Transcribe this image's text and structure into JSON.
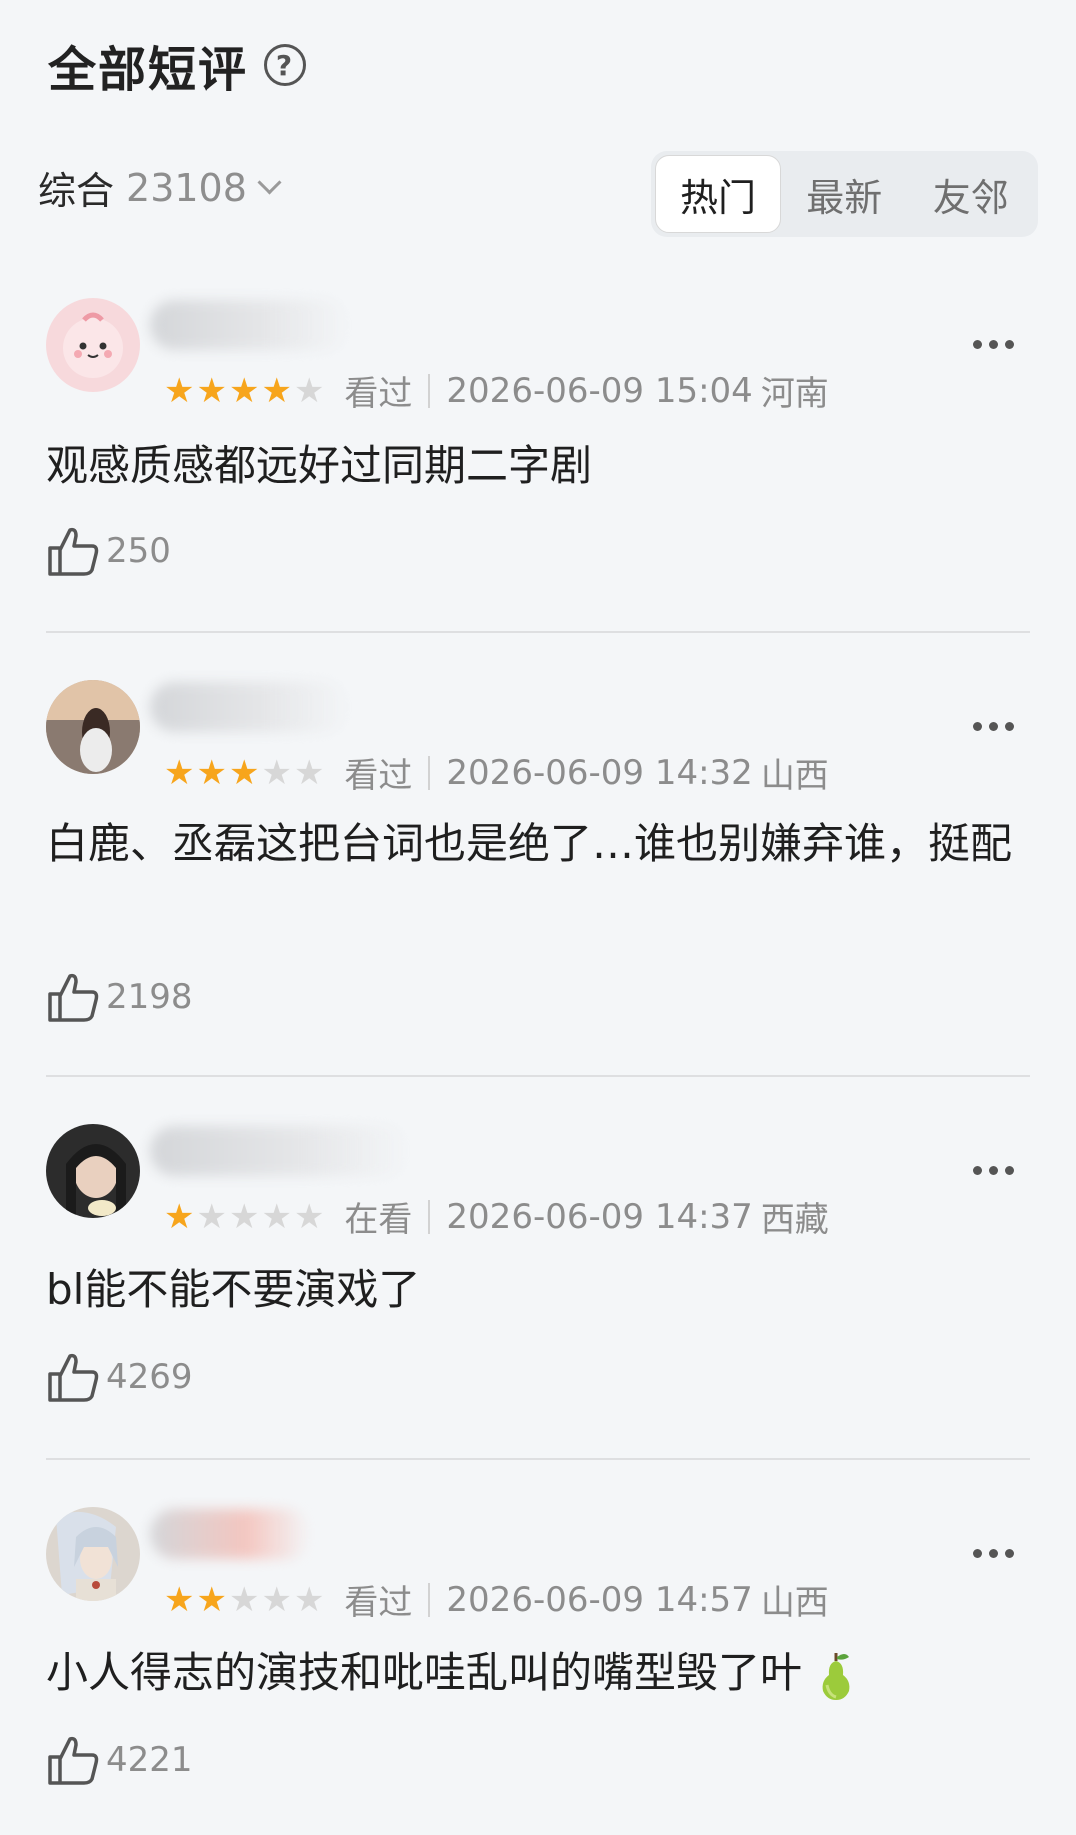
{
  "header": {
    "title": "全部短评",
    "help_icon": "?"
  },
  "sort": {
    "label": "综合",
    "count": "23108"
  },
  "tabs": [
    {
      "label": "热门",
      "active": true
    },
    {
      "label": "最新",
      "active": false
    },
    {
      "label": "友邻",
      "active": false
    }
  ],
  "reviews": [
    {
      "rating": 4,
      "status": "看过",
      "datetime": "2026-06-09 15:04",
      "location": "河南",
      "text": "观感质感都远好过同期二字剧",
      "likes": "250"
    },
    {
      "rating": 3,
      "status": "看过",
      "datetime": "2026-06-09 14:32",
      "location": "山西",
      "text": "白鹿、丞磊这把台词也是绝了…谁也别嫌弃谁，挺配",
      "likes": "2198"
    },
    {
      "rating": 1,
      "status": "在看",
      "datetime": "2026-06-09 14:37",
      "location": "西藏",
      "text": "bl能不能不要演戏了",
      "likes": "4269"
    },
    {
      "rating": 2,
      "status": "看过",
      "datetime": "2026-06-09 14:57",
      "location": "山西",
      "text": "小人得志的演技和吡哇乱叫的嘴型毁了叶",
      "likes": "4221"
    }
  ],
  "colors": {
    "star_on": "#f7a51c",
    "star_off": "#d7d7d7",
    "background": "#f4f6f8"
  },
  "icons": [
    "help-icon",
    "chevron-down-icon",
    "more-icon",
    "thumbs-up-icon",
    "pear-icon"
  ]
}
